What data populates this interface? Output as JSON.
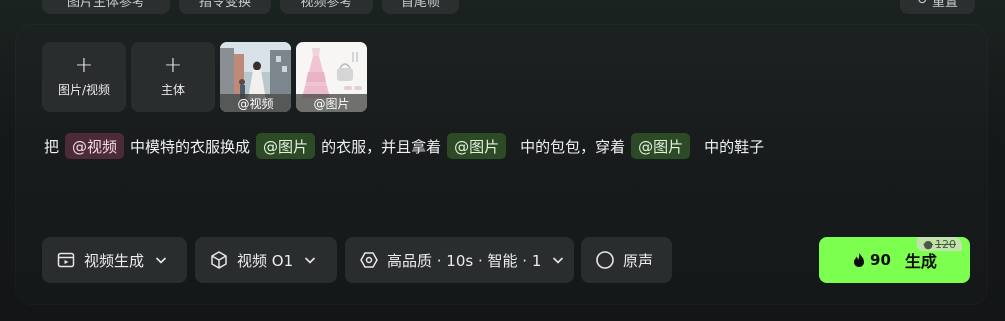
{
  "top_tabs": [
    {
      "label": "图片主体参考"
    },
    {
      "label": "指令变换"
    },
    {
      "label": "视频参考"
    },
    {
      "label": "首尾帧"
    },
    {
      "label": "重置"
    }
  ],
  "uploads": {
    "add_media_label": "图片/视频",
    "add_subject_label": "主体",
    "thumbnails": [
      {
        "caption": "@视频",
        "kind": "video"
      },
      {
        "caption": "@图片",
        "kind": "image"
      }
    ]
  },
  "prompt": {
    "segments": [
      {
        "type": "text",
        "value": "把"
      },
      {
        "type": "video",
        "value": "@视频"
      },
      {
        "type": "text",
        "value": "中模特的衣服换成"
      },
      {
        "type": "image",
        "value": "@图片"
      },
      {
        "type": "text",
        "value": "的衣服，并且拿着"
      },
      {
        "type": "image",
        "value": "@图片"
      },
      {
        "type": "text",
        "value": "中的包包，穿着"
      },
      {
        "type": "image",
        "value": "@图片"
      },
      {
        "type": "text",
        "value": "中的鞋子"
      }
    ]
  },
  "controls": {
    "mode_label": "视频生成",
    "model_label": "视频 O1",
    "settings_label": "高品质 · 10s · 智能 · 1",
    "audio_label": "原声"
  },
  "generate": {
    "cost": "90",
    "label": "生成",
    "original_cost": "120",
    "accent": "#7dff4f"
  },
  "colors": {
    "video_chip": "#4d2a38",
    "image_chip": "#2d4a26"
  }
}
